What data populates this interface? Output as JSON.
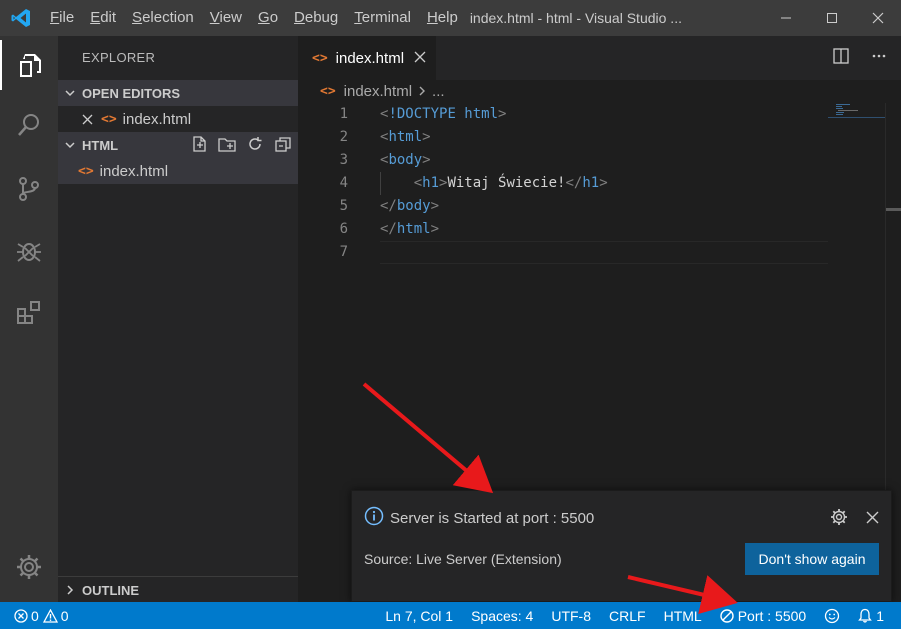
{
  "titlebar": {
    "menu": [
      "File",
      "Edit",
      "Selection",
      "View",
      "Go",
      "Debug",
      "Terminal",
      "Help"
    ],
    "title": "index.html - html - Visual Studio ..."
  },
  "activity": [
    "explorer-icon",
    "search-icon",
    "source-control-icon",
    "debug-icon",
    "extensions-icon",
    "gear-icon"
  ],
  "sidebar": {
    "header": "EXPLORER",
    "open_editors": {
      "label": "OPEN EDITORS",
      "file": "index.html"
    },
    "folder": {
      "label": "HTML",
      "file": "index.html"
    },
    "outline": "OUTLINE"
  },
  "editor": {
    "tab": "index.html",
    "breadcrumb": {
      "file": "index.html",
      "rest": "..."
    },
    "lines": [
      {
        "n": "1",
        "t": "doctype",
        "a": "<!DOCTYPE ",
        "b": "html",
        "c": ">"
      },
      {
        "n": "2",
        "t": "open",
        "tag": "html"
      },
      {
        "n": "3",
        "t": "open",
        "tag": "body"
      },
      {
        "n": "4",
        "t": "h1",
        "tag": "h1",
        "text": "Witaj Świecie!"
      },
      {
        "n": "5",
        "t": "close",
        "tag": "body"
      },
      {
        "n": "6",
        "t": "close",
        "tag": "html"
      },
      {
        "n": "7",
        "t": "empty"
      }
    ]
  },
  "notification": {
    "message": "Server is Started at port : 5500",
    "source": "Source: Live Server (Extension)",
    "button": "Don't show again"
  },
  "statusbar": {
    "errors": "0",
    "warnings": "0",
    "position": "Ln 7, Col 1",
    "spaces": "Spaces: 4",
    "encoding": "UTF-8",
    "eol": "CRLF",
    "language": "HTML",
    "port": "Port : 5500",
    "notifications": "1"
  },
  "colors": {
    "accent": "#007acc",
    "arrow": "#e8191b",
    "html_icon": "#e37933",
    "tag": "#569cd6"
  }
}
